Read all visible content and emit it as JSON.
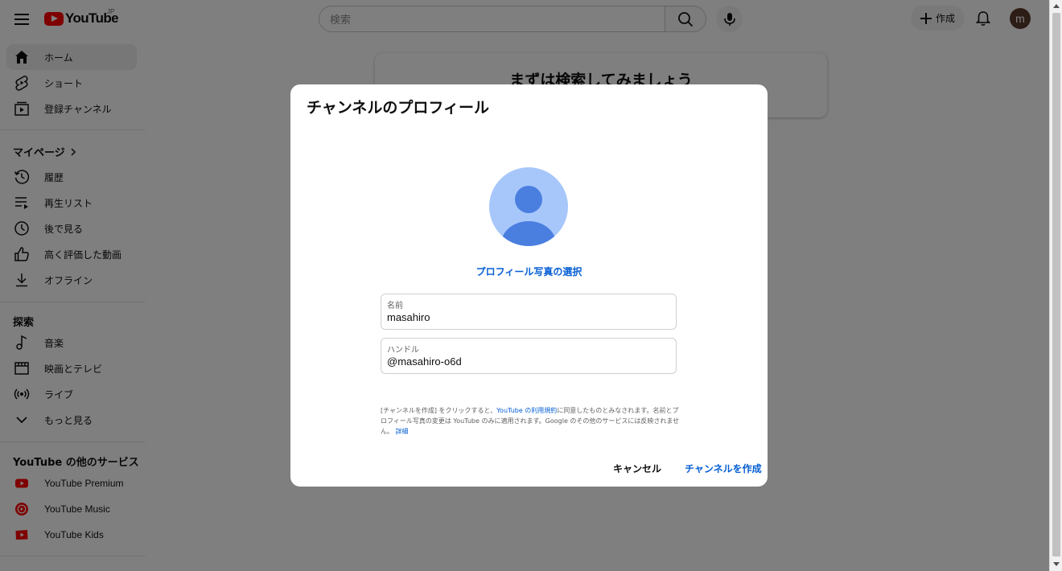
{
  "header": {
    "logo_text": "YouTube",
    "country_code": "JP",
    "search_placeholder": "検索",
    "create_label": "作成",
    "avatar_letter": "m"
  },
  "sidebar": {
    "main_items": [
      {
        "label": "ホーム",
        "icon": "home-icon"
      },
      {
        "label": "ショート",
        "icon": "shorts-icon"
      },
      {
        "label": "登録チャンネル",
        "icon": "subscriptions-icon"
      }
    ],
    "you_section": {
      "title": "マイページ",
      "items": [
        {
          "label": "履歴",
          "icon": "history-icon"
        },
        {
          "label": "再生リスト",
          "icon": "playlist-icon"
        },
        {
          "label": "後で見る",
          "icon": "watch-later-icon"
        },
        {
          "label": "高く評価した動画",
          "icon": "thumbs-up-icon"
        },
        {
          "label": "オフライン",
          "icon": "download-icon"
        }
      ]
    },
    "explore_section": {
      "title": "探索",
      "items": [
        {
          "label": "音楽",
          "icon": "music-note-icon"
        },
        {
          "label": "映画とテレビ",
          "icon": "movies-icon"
        },
        {
          "label": "ライブ",
          "icon": "live-icon"
        },
        {
          "label": "もっと見る",
          "icon": "chevron-down-icon"
        }
      ]
    },
    "more_section": {
      "title": "YouTube の他のサービス",
      "items": [
        {
          "label": "YouTube Premium",
          "icon": "youtube-premium-icon"
        },
        {
          "label": "YouTube Music",
          "icon": "youtube-music-icon"
        },
        {
          "label": "YouTube Kids",
          "icon": "youtube-kids-icon"
        }
      ]
    }
  },
  "background_card": {
    "title": "まずは検索してみましょう"
  },
  "dialog": {
    "title": "チャンネルのプロフィール",
    "select_photo": "プロフィール写真の選択",
    "name_label": "名前",
    "name_value": "masahiro",
    "handle_label": "ハンドル",
    "handle_value": "@masahiro-o6d",
    "legal_part1": "[チャンネルを作成] をクリックすると、",
    "legal_link": "YouTube の利用規約",
    "legal_part2": "に同意したものとみなされます。名前とプロフィール写真の変更は YouTube のみに適用されます。Google のその他のサービスには反映されません。",
    "legal_more": "詳細",
    "cancel_label": "キャンセル",
    "create_label": "チャンネルを作成"
  },
  "colors": {
    "brand_red": "#ff0000",
    "link_blue": "#065fd4",
    "avatar_light": "#a7c7fb",
    "avatar_dark": "#4a7fe0"
  }
}
